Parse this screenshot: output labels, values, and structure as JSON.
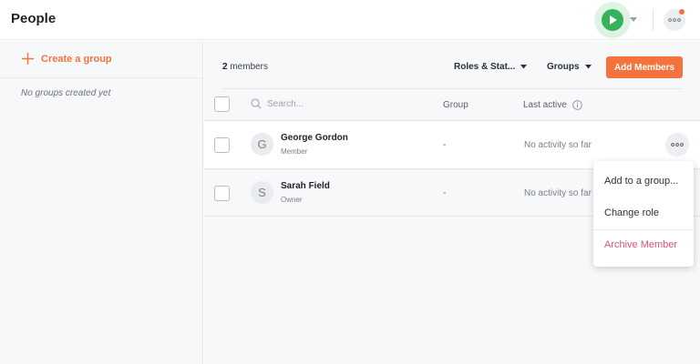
{
  "header": {
    "title": "People",
    "icons": {
      "play": "play-icon",
      "caret": "chevron-down-icon",
      "more": "more-horizontal-icon"
    },
    "colors": {
      "accent": "#f4733c",
      "play": "#34b35a",
      "notification": "#f4733c"
    }
  },
  "sidebar": {
    "create_group_label": "Create a group",
    "empty_text": "No groups created yet"
  },
  "toolbar": {
    "member_count": "2",
    "member_count_suffix": " members",
    "roles_filter": "Roles & Stat...",
    "groups_filter": "Groups",
    "add_members_label": "Add Members"
  },
  "table": {
    "search_placeholder": "Search...",
    "columns": {
      "group": "Group",
      "last_active": "Last active"
    },
    "rows": [
      {
        "initial": "G",
        "name": "George Gordon",
        "role": "Member",
        "group": "-",
        "last_active": "No activity so far"
      },
      {
        "initial": "S",
        "name": "Sarah Field",
        "role": "Owner",
        "group": "-",
        "last_active": "No activity so far"
      }
    ]
  },
  "menu": {
    "add_to_group": "Add to a group...",
    "change_role": "Change role",
    "archive": "Archive Member"
  }
}
